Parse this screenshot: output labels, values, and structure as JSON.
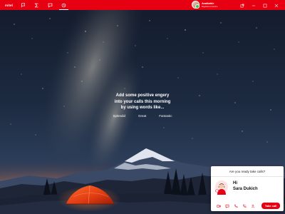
{
  "app": {
    "brand": "mitel"
  },
  "nav": {
    "items": [
      {
        "icon": "flag-icon"
      },
      {
        "icon": "sigma-icon"
      },
      {
        "icon": "chat-icon"
      },
      {
        "icon": "history-icon",
        "active": true
      }
    ]
  },
  "presence": {
    "status": "Available",
    "sub": "Registered device",
    "status_color": "#3ac14b"
  },
  "window_controls": {
    "icons": [
      "popout-icon",
      "minimize-icon",
      "maximize-icon",
      "close-icon"
    ]
  },
  "message": {
    "line1": "Add some positive engery",
    "line2": "into your calls this morning",
    "line3": "by using words like...",
    "words": [
      "Splendid",
      "Great",
      "Fantastic"
    ]
  },
  "call_card": {
    "question": "Are you ready take calls?",
    "greeting": "Hi",
    "name": "Sara Dukich",
    "button": "Take call",
    "icons": [
      "video-icon",
      "message-icon",
      "phone-icon",
      "voicemail-icon",
      "contact-icon"
    ]
  },
  "colors": {
    "brand_red": "#e60012",
    "card_bg": "#ffffff"
  }
}
